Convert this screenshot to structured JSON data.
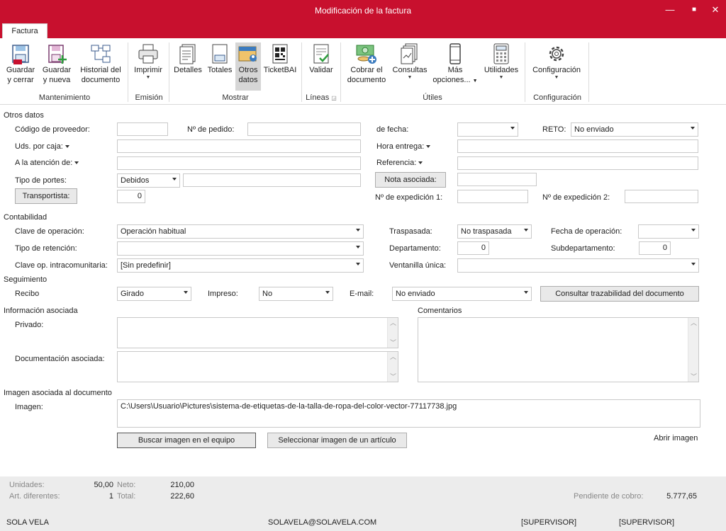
{
  "window": {
    "title": "Modificación de la factura",
    "minimize_glyph": "—",
    "maximize_glyph": "■",
    "close_glyph": "✕"
  },
  "tab": {
    "label": "Factura"
  },
  "ribbon": {
    "buttons": {
      "guardar_cerrar": {
        "line1": "Guardar",
        "line2": "y cerrar",
        "icon": "save-close-icon"
      },
      "guardar_nueva": {
        "line1": "Guardar",
        "line2": "y nueva",
        "icon": "save-new-icon"
      },
      "historial": {
        "line1": "Historial del",
        "line2": "documento",
        "icon": "history-icon"
      },
      "imprimir": {
        "line1": "Imprimir",
        "icon": "printer-icon"
      },
      "detalles": {
        "line1": "Detalles",
        "icon": "details-icon"
      },
      "totales": {
        "line1": "Totales",
        "icon": "totals-icon"
      },
      "otros_datos": {
        "line1": "Otros",
        "line2": "datos",
        "icon": "other-data-icon"
      },
      "ticketbai": {
        "line1": "TicketBAI",
        "icon": "qr-code-icon"
      },
      "validar": {
        "line1": "Validar",
        "icon": "validate-icon"
      },
      "cobrar": {
        "line1": "Cobrar el",
        "line2": "documento",
        "icon": "collect-money-icon"
      },
      "consultas": {
        "line1": "Consultas",
        "icon": "queries-icon"
      },
      "mas_opciones": {
        "line1": "Más",
        "line2": "opciones...",
        "icon": "mobile-icon"
      },
      "utilidades": {
        "line1": "Utilidades",
        "icon": "calculator-icon"
      },
      "configuracion": {
        "line1": "Configuración",
        "icon": "gear-icon"
      }
    },
    "groups": {
      "mantenimiento": "Mantenimiento",
      "emision": "Emisión",
      "mostrar": "Mostrar",
      "lineas": "Líneas",
      "utiles": "Útiles",
      "configuracion": "Configuración"
    }
  },
  "otros_datos": {
    "section": "Otros datos",
    "codigo_proveedor": {
      "label": "Código de proveedor:",
      "value": ""
    },
    "n_pedido": {
      "label": "Nº de pedido:",
      "value": ""
    },
    "de_fecha": {
      "label": "de fecha:",
      "value": ""
    },
    "reto": {
      "label": "RETO:",
      "value": "No enviado"
    },
    "uds_por_caja": {
      "label": "Uds. por caja:",
      "value": ""
    },
    "hora_entrega": {
      "label": "Hora entrega:",
      "value": ""
    },
    "a_la_atencion": {
      "label": "A la atención de:",
      "value": ""
    },
    "referencia": {
      "label": "Referencia:",
      "value": ""
    },
    "tipo_portes": {
      "label": "Tipo de portes:",
      "value": "Debidos",
      "extra": ""
    },
    "nota_asociada": {
      "label": "Nota asociada:",
      "value": ""
    },
    "transportista": {
      "label": "Transportista:",
      "value": "0"
    },
    "n_expedicion_1": {
      "label": "Nº de expedición 1:",
      "value": ""
    },
    "n_expedicion_2": {
      "label": "Nº de expedición 2:",
      "value": ""
    }
  },
  "contabilidad": {
    "section": "Contabilidad",
    "clave_operacion": {
      "label": "Clave de operación:",
      "value": "Operación habitual"
    },
    "traspasada": {
      "label": "Traspasada:",
      "value": "No traspasada"
    },
    "fecha_operacion": {
      "label": "Fecha de operación:",
      "value": ""
    },
    "tipo_retencion": {
      "label": "Tipo de retención:",
      "value": ""
    },
    "departamento": {
      "label": "Departamento:",
      "value": "0"
    },
    "subdepartamento": {
      "label": "Subdepartamento:",
      "value": "0"
    },
    "clave_intracomunitaria": {
      "label": "Clave op. intracomunitaria:",
      "value": "[Sin predefinir]"
    },
    "ventanilla_unica": {
      "label": "Ventanilla única:",
      "value": ""
    }
  },
  "seguimiento": {
    "section": "Seguimiento",
    "recibo": {
      "label": "Recibo",
      "value": "Girado"
    },
    "impreso": {
      "label": "Impreso:",
      "value": "No"
    },
    "email": {
      "label": "E-mail:",
      "value": "No enviado"
    },
    "consultar_btn": "Consultar trazabilidad del documento"
  },
  "info_asociada": {
    "section": "Información asociada",
    "privado": {
      "label": "Privado:",
      "value": ""
    },
    "documentacion": {
      "label": "Documentación asociada:",
      "value": ""
    },
    "comentarios": {
      "label": "Comentarios",
      "value": ""
    }
  },
  "imagen": {
    "section": "Imagen asociada al documento",
    "label": "Imagen:",
    "path": "C:\\Users\\Usuario\\Pictures\\sistema-de-etiquetas-de-la-talla-de-ropa-del-color-vector-77117738.jpg",
    "buscar_btn": "Buscar imagen en el equipo",
    "seleccionar_btn": "Seleccionar imagen de un artículo",
    "abrir_link": "Abrir imagen"
  },
  "totales": {
    "unidades_label": "Unidades:",
    "unidades_value": "50,00",
    "art_label": "Art. diferentes:",
    "art_value": "1",
    "neto_label": "Neto:",
    "neto_value": "210,00",
    "total_label": "Total:",
    "total_value": "222,60",
    "pendiente_label": "Pendiente de cobro:",
    "pendiente_value": "5.777,65"
  },
  "statusbar": {
    "company": "SOLA VELA",
    "email": "SOLAVELA@SOLAVELA.COM",
    "user1": "[SUPERVISOR]",
    "user2": "[SUPERVISOR]"
  },
  "colors": {
    "accent": "#c8102e"
  }
}
